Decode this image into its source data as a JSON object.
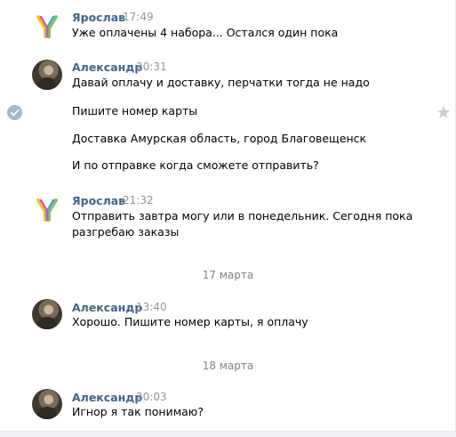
{
  "messages": [
    {
      "author": "Ярослав",
      "time": "17:49",
      "lines": [
        "Уже оплачены 4 набора... Остался один пока"
      ]
    },
    {
      "author": "Александр",
      "time": "20:31",
      "lines": [
        "Давай оплачу и доставку, перчатки тогда не надо",
        "Пишите номер карты",
        "Доставка Амурская область, город Благовещенск",
        "И по отправке когда сможете отправить?"
      ]
    },
    {
      "author": "Ярослав",
      "time": "21:32",
      "lines": [
        "Отправить завтра могу или в понедельник. Сегодня пока",
        "разгребаю заказы"
      ]
    },
    {
      "author": "Александр",
      "time": "13:40",
      "lines": [
        "Хорошо. Пишите номер карты, я оплачу"
      ]
    },
    {
      "author": "Александр",
      "time": "20:03",
      "lines": [
        "Игнор я так понимаю?"
      ]
    }
  ],
  "date_separators": [
    "17 марта",
    "18 марта"
  ],
  "icons": {
    "selected_check": "check-circle-icon",
    "favorite": "star-icon",
    "avatar_yaroslav": "y-logo-avatar",
    "avatar_alexander": "photo-avatar"
  },
  "colors": {
    "author_name": "#42648b",
    "timestamp": "#939393",
    "date_separator": "#828282",
    "check_circle": "#a3b8cf",
    "star": "#c5d0db"
  }
}
